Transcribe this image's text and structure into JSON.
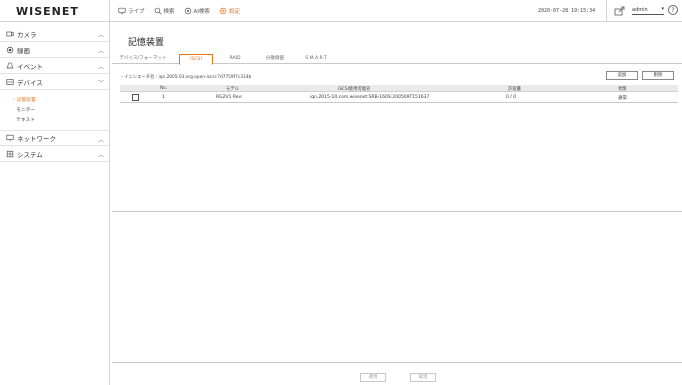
{
  "header": {
    "logo": "WISENET",
    "nav": [
      {
        "label": "ライブ",
        "icon": "monitor-icon"
      },
      {
        "label": "検索",
        "icon": "search-icon"
      },
      {
        "label": "AI検索",
        "icon": "ai-search-icon"
      },
      {
        "label": "設定",
        "icon": "gear-icon"
      }
    ],
    "datetime": "2020-07-28 19:15:34",
    "user": "admin",
    "help": "?"
  },
  "sidebar": {
    "items": [
      {
        "label": "カメラ",
        "icon": "camera-icon",
        "expanded": false
      },
      {
        "label": "録画",
        "icon": "record-icon",
        "expanded": false
      },
      {
        "label": "イベント",
        "icon": "event-icon",
        "expanded": false
      },
      {
        "label": "デバイス",
        "icon": "device-icon",
        "expanded": true
      },
      {
        "label": "ネットワーク",
        "icon": "network-icon",
        "expanded": false
      },
      {
        "label": "システム",
        "icon": "system-icon",
        "expanded": false
      }
    ],
    "sub_items": [
      "記憶装置",
      "モニター",
      "テキスト"
    ]
  },
  "main": {
    "title": "記憶装置",
    "tabs": [
      "デバイス/フォーマット",
      "iSCSI",
      "RAID",
      "分散録画",
      "S.M.A.R.T"
    ],
    "active_tab": "iSCSI",
    "iscsi_name": "・イニシエータ名 : iqn.2005-03.org.open-iscsi:7d7759f7c314b",
    "buttons": {
      "add": "追加",
      "delete": "削除"
    },
    "table": {
      "headers": [
        "No.",
        "モデル",
        "iSCSI使用可能名",
        "許容量",
        "状態"
      ],
      "rows": [
        {
          "no": "1",
          "model": "RG2V1 Rev:",
          "name": "iqn.2015-10.com.wisenet:SRB-160S:200509T151637",
          "capacity": "0 / 0",
          "status": "通常"
        }
      ]
    },
    "footer": {
      "apply": "適用",
      "cancel": "取消"
    }
  },
  "colors": {
    "accent": "#e8731d",
    "border": "#d4d4d4",
    "header_bg": "#eaeaea"
  }
}
